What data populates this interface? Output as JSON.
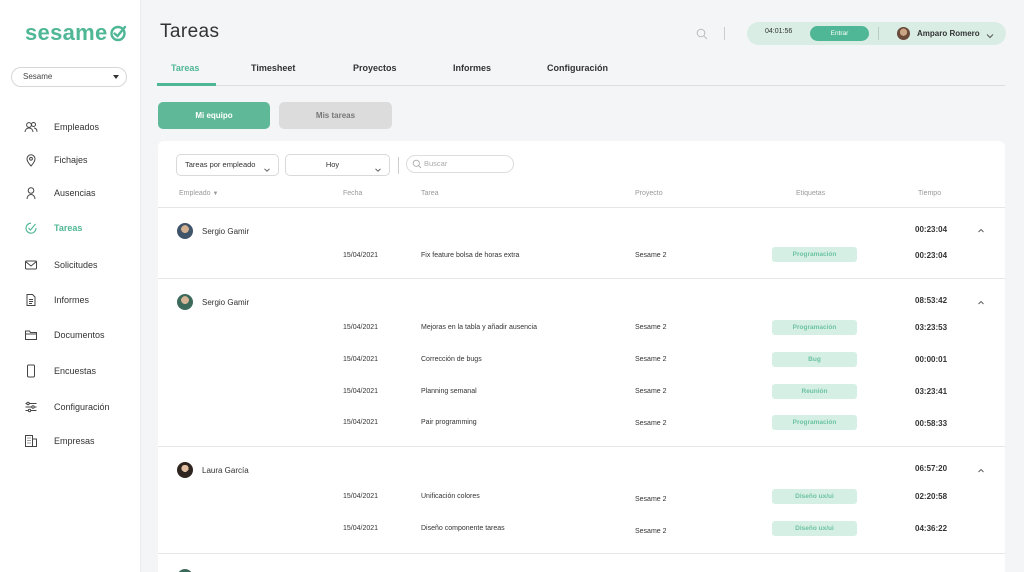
{
  "brand": {
    "logo_text": "sesame",
    "accent": "#4fb795"
  },
  "company_select": {
    "value": "Sesame"
  },
  "sidebar": {
    "items": [
      {
        "label": "Empleados",
        "icon": "users-icon"
      },
      {
        "label": "Fichajes",
        "icon": "location-pin-icon"
      },
      {
        "label": "Ausencias",
        "icon": "person-icon"
      },
      {
        "label": "Tareas",
        "icon": "tasks-icon",
        "active": true
      },
      {
        "label": "Solicitudes",
        "icon": "mail-icon"
      },
      {
        "label": "Informes",
        "icon": "document-icon"
      },
      {
        "label": "Documentos",
        "icon": "folder-icon"
      },
      {
        "label": "Encuestas",
        "icon": "phone-icon"
      },
      {
        "label": "Configuración",
        "icon": "sliders-icon"
      },
      {
        "label": "Empresas",
        "icon": "building-icon"
      }
    ]
  },
  "header": {
    "title": "Tareas",
    "clock": {
      "time": "04:01:56",
      "button": "Entrar"
    },
    "user": {
      "name": "Amparo Romero"
    }
  },
  "tabs": [
    "Tareas",
    "Timesheet",
    "Proyectos",
    "Informes",
    "Configuración"
  ],
  "toggle": {
    "team": "Mi equipo",
    "mine": "Mis tareas"
  },
  "filters": {
    "group_by": "Tareas por empleado",
    "period": "Hoy",
    "search_placeholder": "Buscar"
  },
  "columns": {
    "employee": "Empleado",
    "date": "Fecha",
    "task": "Tarea",
    "project": "Proyecto",
    "tags": "Etiquetas",
    "time": "Tiempo"
  },
  "groups": [
    {
      "employee": "Sergio Gamir",
      "total": "00:23:04",
      "rows": [
        {
          "date": "15/04/2021",
          "task": "Fix feature bolsa de horas extra",
          "project": "Sesame 2",
          "tag": "Programación",
          "time": "00:23:04"
        }
      ]
    },
    {
      "employee": "Sergio Gamir",
      "total": "08:53:42",
      "rows": [
        {
          "date": "15/04/2021",
          "task": "Mejoras en la tabla y añadir ausencia",
          "project": "Sesame 2",
          "tag": "Programación",
          "time": "03:23:53"
        },
        {
          "date": "15/04/2021",
          "task": "Corrección de bugs",
          "project": "Sesame 2",
          "tag": "Bug",
          "time": "00:00:01"
        },
        {
          "date": "15/04/2021",
          "task": "Planning semanal",
          "project": "Sesame 2",
          "tag": "Reunión",
          "time": "03:23:41"
        },
        {
          "date": "15/04/2021",
          "task": "Pair programming",
          "project": "Sesame 2",
          "tag": "Programación",
          "time": "00:58:33"
        }
      ]
    },
    {
      "employee": "Laura García",
      "total": "06:57:20",
      "rows": [
        {
          "date": "15/04/2021",
          "task": "Unificación colores",
          "project": "Sesame 2",
          "tag": "Diseño ux/ui",
          "time": "02:20:58"
        },
        {
          "date": "15/04/2021",
          "task": "Diseño componente tareas",
          "project": "Sesame 2",
          "tag": "Diseño ux/ui",
          "time": "04:36:22"
        }
      ]
    }
  ]
}
